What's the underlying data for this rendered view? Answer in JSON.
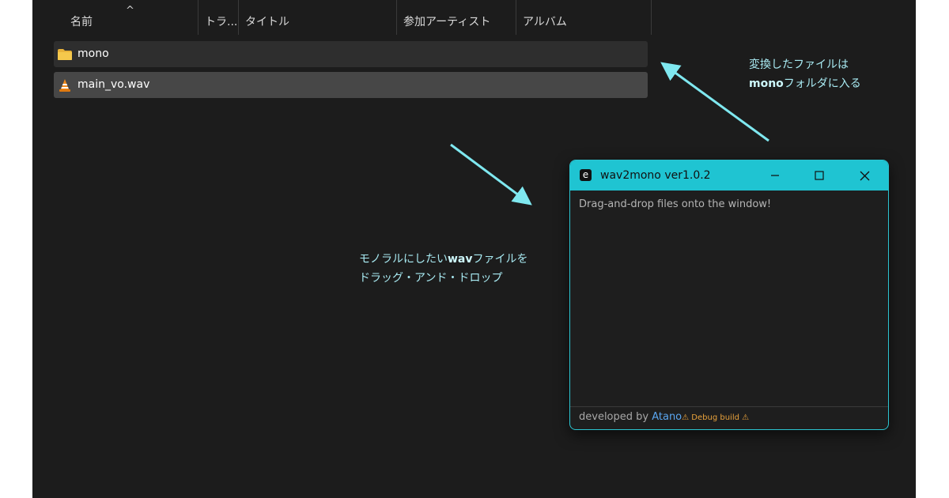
{
  "explorer": {
    "columns": [
      "名前",
      "トラ...",
      "タイトル",
      "参加アーティスト",
      "アルバム"
    ],
    "sort_indicator": "^",
    "rows": [
      {
        "name": "mono",
        "icon": "folder-icon"
      },
      {
        "name": "main_vo.wav",
        "icon": "vlc-cone-icon"
      }
    ]
  },
  "annotations": {
    "top_right_line1": "変換したファイルは",
    "top_right_line2_bold": "mono",
    "top_right_line2_rest": "フォルダに入る",
    "middle_line1_pre": "モノラルにしたい",
    "middle_line1_bold": "wav",
    "middle_line1_post": "ファイルを",
    "middle_line2": "ドラッグ・アンド・ドロップ",
    "arrow_color": "#7fe8f0"
  },
  "app": {
    "logo_letter": "e",
    "title": "wav2mono ver1.0.2",
    "drop_hint": "Drag-and-drop files onto the window!",
    "footer_prefix": "developed by ",
    "footer_author": "Atano",
    "footer_debug": "⚠ Debug build ⚠",
    "accent_color": "#1fc4d2"
  }
}
